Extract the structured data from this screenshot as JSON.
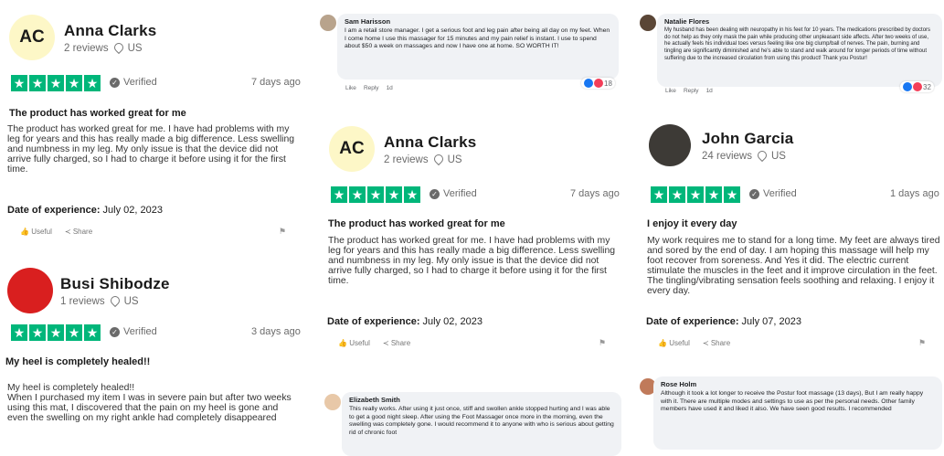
{
  "colors": {
    "star_green": "#00b67a",
    "fb_bubble": "#f0f2f5"
  },
  "cards": [
    {
      "initials": "AC",
      "name": "Anna Clarks",
      "reviews": "2 reviews",
      "country": "US",
      "verified": "Verified",
      "ago": "7 days ago",
      "title": "The product has worked great for me",
      "body": "The product has worked great for me. I have had problems with my leg for years and this has really made a big difference. Less swelling and numbness in my leg. My only issue is that the device did not arrive fully charged, so I had to charge it before using it for the first time.",
      "date_label": "Date of experience:",
      "date": "July 02, 2023",
      "useful": "Useful",
      "share": "Share"
    },
    {
      "initials": "",
      "name": "Busi Shibodze",
      "reviews": "1 reviews",
      "country": "US",
      "verified": "Verified",
      "ago": "3 days ago",
      "title": "My heel is completely healed!!",
      "body": "My heel is completely healed!!\nWhen I purchased my item I was in severe pain but after two weeks using this mat, I discovered that the pain on my heel is gone and even the swelling on my right ankle had completely disappeared",
      "date_label": "",
      "date": "",
      "useful": "",
      "share": ""
    },
    {
      "initials": "AC",
      "name": "Anna Clarks",
      "reviews": "2 reviews",
      "country": "US",
      "verified": "Verified",
      "ago": "7 days ago",
      "title": "The product has worked great for me",
      "body": "The product has worked great for me. I have had problems with my leg for years and this has really made a big difference. Less swelling and numbness in my leg. My only issue is that the device did not arrive fully charged, so I had to charge it before using it for the first time.",
      "date_label": "Date of experience:",
      "date": "July 02, 2023",
      "useful": "Useful",
      "share": "Share"
    },
    {
      "initials": "",
      "name": "John Garcia",
      "reviews": "24 reviews",
      "country": "US",
      "verified": "Verified",
      "ago": "1 days ago",
      "title": "I enjoy it every day",
      "body": "My work requires me to stand for a long time. My feet are always tired and sored by the end of day. I am hoping this massage will help my foot recover from soreness. And Yes it did. The electric current stimulate the muscles in the feet and it improve circulation in the feet. The tingling/vibrating sensation feels soothing and relaxing. I enjoy it every day.",
      "date_label": "Date of experience:",
      "date": "July 07, 2023",
      "useful": "Useful",
      "share": "Share"
    }
  ],
  "fb": [
    {
      "name": "Sam Harisson",
      "text": "I am a retail store manager. I get a serious foot and leg pain after being all day on my feet. When I come home I use this massager for 15 minutes and my pain relief is instant. I use to spend about $50 a week on massages and now I have one at home. SO WORTH IT!",
      "like": "Like",
      "reply": "Reply",
      "time": "1d",
      "count": "18"
    },
    {
      "name": "Natalie Flores",
      "text": "My husband has been dealing with neuropathy in his feet for 10 years. The medications prescribed by doctors do not help as they only mask the pain while producing other unpleasant side affects. After two weeks of use, he actually feels his individual toes versus feeling like one big clump/ball of nerves. The pain, burning and tingling are significantly diminished and he's able to stand and walk around for longer periods of time without suffering due to the increased circulation from using this product! Thank you Postur!",
      "like": "Like",
      "reply": "Reply",
      "time": "1d",
      "count": "32"
    },
    {
      "name": "Elizabeth Smith",
      "text": "This really works. After using it just once, stiff and swollen ankle stopped hurting and I was able to get a good night sleep. After using the Foot Massager once more in the morning, even the swelling was completely gone. I would recommend it to anyone with who is serious about getting rid of chronic foot",
      "like": "",
      "reply": "",
      "time": "",
      "count": ""
    },
    {
      "name": "Rose Holm",
      "text": "Although it took a lot longer to receive the Postur foot massage (13 days), But I am really happy with it. There are multiple modes and settings to use as per the personal needs. Other family members have used it and liked it also. We have seen good results. I recommended",
      "like": "",
      "reply": "",
      "time": "",
      "count": ""
    }
  ]
}
